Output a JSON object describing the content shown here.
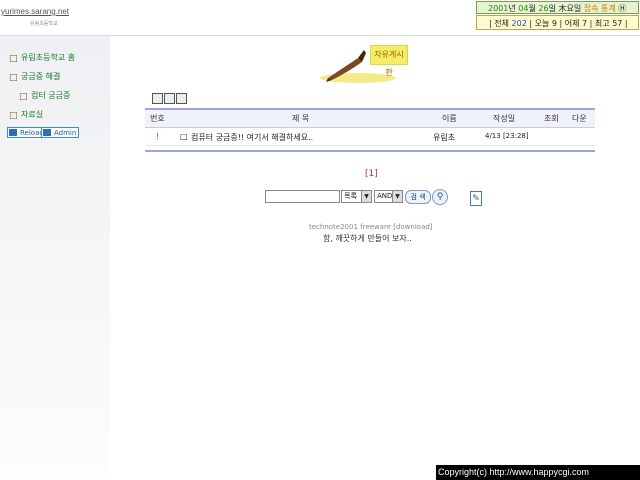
{
  "header": {
    "logo_url": "yurimes.sarang.net",
    "logo_sub": "유림초등학교"
  },
  "date_bar": {
    "year": "2001",
    "year_suffix": "년",
    "month": "04",
    "month_suffix": "월",
    "day": "26",
    "day_suffix": "일",
    "weekday": "木요일",
    "stats_link": "접속 통계",
    "help": "Ⓗ"
  },
  "stats": {
    "total_label": "전체",
    "total": "202",
    "today_label": "오늘",
    "today": "9",
    "yesterday_label": "어제",
    "yesterday": "7",
    "max_label": "최고",
    "max": "57"
  },
  "sidebar": {
    "items": [
      {
        "label": "유림초등학교 홈"
      },
      {
        "label": "궁금증 해결"
      },
      {
        "label": "컴터 궁금증"
      },
      {
        "label": "자료실"
      }
    ],
    "reload_label": "Reload",
    "admin_label": "Admin"
  },
  "banner": {
    "label": "자유게시판"
  },
  "table": {
    "headers": {
      "no": "번호",
      "subject": "제 목",
      "name": "이름",
      "date": "작성일",
      "views": "조회",
      "down": "다운"
    },
    "rows": [
      {
        "no": "!",
        "subject": "컴퓨터 궁금증!! 여기서 해결하세요..",
        "name": "유림초",
        "date": "4/13 [23:28]",
        "views": "",
        "down": ""
      }
    ]
  },
  "pagination": {
    "current": "[1]"
  },
  "search": {
    "input_value": "",
    "field_option": "목록",
    "logic_option": "AND",
    "go_label": "검 색"
  },
  "footer": {
    "credit": "technote2001 freeware [download]",
    "slogan": "함, 깨끗하게 만들어 보자.."
  },
  "copyright": "Copyright(c) http://www.happycgi.com"
}
